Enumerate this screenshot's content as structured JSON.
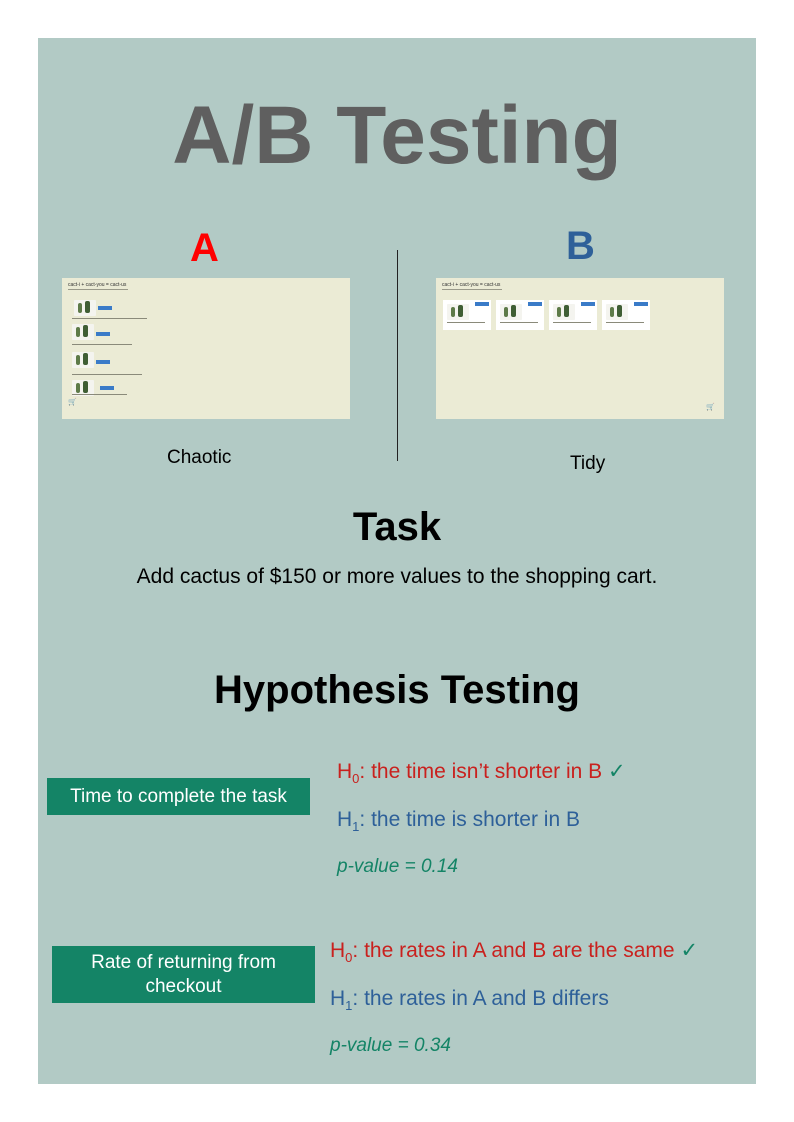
{
  "title": "A/B Testing",
  "variants": {
    "a": {
      "letter": "A",
      "caption": "Chaotic",
      "mock_header": "cact-i + cact-you = cact-us"
    },
    "b": {
      "letter": "B",
      "caption": "Tidy",
      "mock_header": "cact-i + cact-you = cact-us"
    }
  },
  "task": {
    "title": "Task",
    "text": "Add cactus of $150 or more values to the shopping cart."
  },
  "hypothesis": {
    "title": "Hypothesis Testing",
    "tests": [
      {
        "metric": "Time to complete the task",
        "h0_label": "H",
        "h0_sub": "0",
        "h0_text": ": the time isn’t shorter in B",
        "h1_label": "H",
        "h1_sub": "1",
        "h1_text": ": the time is shorter in B",
        "check": "✓",
        "p_value": "p-value = 0.14"
      },
      {
        "metric": "Rate of returning from checkout",
        "h0_label": "H",
        "h0_sub": "0",
        "h0_text": ": the rates in A and B are the same",
        "h1_label": "H",
        "h1_sub": "1",
        "h1_text": ": the rates in A and B differs",
        "check": "✓",
        "p_value": "p-value = 0.34"
      }
    ]
  },
  "colors": {
    "panel": "#b2cac5",
    "title": "#5f5f5f",
    "a": "#ff0000",
    "b": "#2e6099",
    "h0": "#c9211e",
    "accent": "#148466"
  }
}
